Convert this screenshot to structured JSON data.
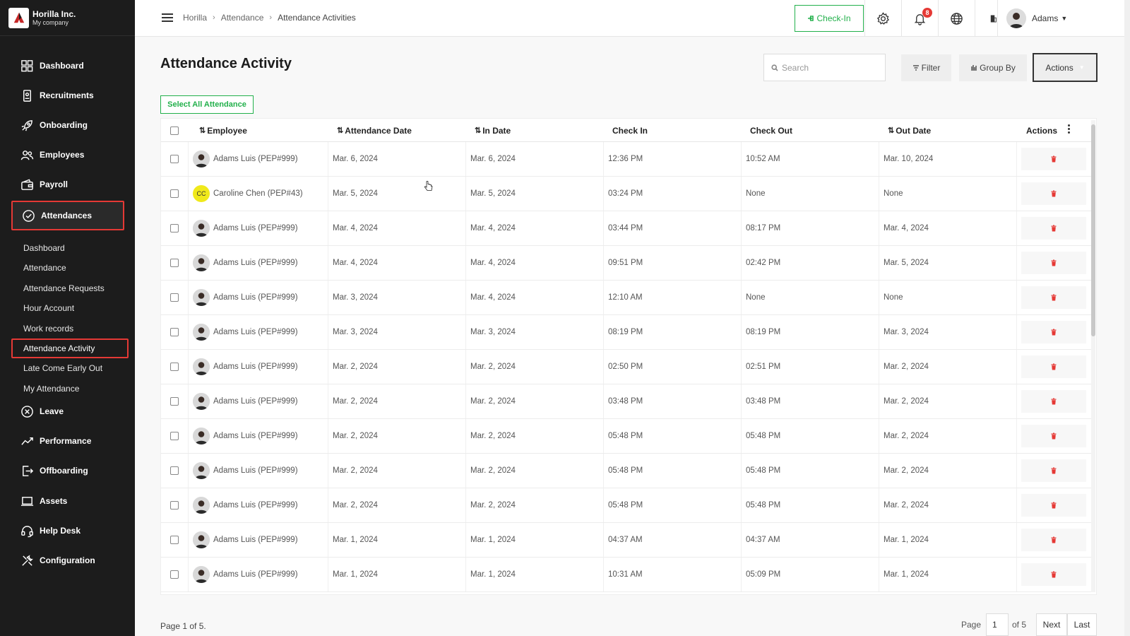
{
  "company": {
    "name": "Horilla Inc.",
    "subtitle": "My company"
  },
  "sidebar": {
    "items": [
      {
        "label": "Dashboard",
        "icon": "dashboard-icon"
      },
      {
        "label": "Recruitments",
        "icon": "recruitment-icon"
      },
      {
        "label": "Onboarding",
        "icon": "rocket-icon"
      },
      {
        "label": "Employees",
        "icon": "users-icon"
      },
      {
        "label": "Payroll",
        "icon": "wallet-icon"
      },
      {
        "label": "Attendances",
        "icon": "check-circle-icon",
        "active": true
      },
      {
        "label": "Leave",
        "icon": "leave-icon"
      },
      {
        "label": "Performance",
        "icon": "chart-line-icon"
      },
      {
        "label": "Offboarding",
        "icon": "exit-icon"
      },
      {
        "label": "Assets",
        "icon": "laptop-icon"
      },
      {
        "label": "Help Desk",
        "icon": "headset-icon"
      },
      {
        "label": "Configuration",
        "icon": "tools-icon"
      }
    ],
    "sub_items": [
      {
        "label": "Dashboard"
      },
      {
        "label": "Attendance"
      },
      {
        "label": "Attendance Requests"
      },
      {
        "label": "Hour Account"
      },
      {
        "label": "Work records"
      },
      {
        "label": "Attendance Activity",
        "active": true
      },
      {
        "label": "Late Come Early Out"
      },
      {
        "label": "My Attendance"
      }
    ]
  },
  "topbar": {
    "breadcrumbs": [
      "Horilla",
      "Attendance",
      "Attendance Activities"
    ],
    "checkin_label": "Check-In",
    "notification_count": "8",
    "user_name": "Adams"
  },
  "main": {
    "title": "Attendance Activity",
    "search_placeholder": "Search",
    "filter_label": "Filter",
    "groupby_label": "Group By",
    "actions_label": "Actions",
    "select_all_label": "Select All Attendance"
  },
  "table": {
    "columns": [
      "Employee",
      "Attendance Date",
      "In Date",
      "Check In",
      "Check Out",
      "Out Date",
      "Actions"
    ],
    "rows": [
      {
        "employee": "Adams Luis (PEP#999)",
        "avatar": "photo",
        "attendance_date": "Mar. 6, 2024",
        "in_date": "Mar. 6, 2024",
        "check_in": "12:36 PM",
        "check_out": "10:52 AM",
        "out_date": "Mar. 10, 2024"
      },
      {
        "employee": "Caroline Chen (PEP#43)",
        "avatar": "CC",
        "attendance_date": "Mar. 5, 2024",
        "in_date": "Mar. 5, 2024",
        "check_in": "03:24 PM",
        "check_out": "None",
        "out_date": "None"
      },
      {
        "employee": "Adams Luis (PEP#999)",
        "avatar": "photo",
        "attendance_date": "Mar. 4, 2024",
        "in_date": "Mar. 4, 2024",
        "check_in": "03:44 PM",
        "check_out": "08:17 PM",
        "out_date": "Mar. 4, 2024"
      },
      {
        "employee": "Adams Luis (PEP#999)",
        "avatar": "photo",
        "attendance_date": "Mar. 4, 2024",
        "in_date": "Mar. 4, 2024",
        "check_in": "09:51 PM",
        "check_out": "02:42 PM",
        "out_date": "Mar. 5, 2024"
      },
      {
        "employee": "Adams Luis (PEP#999)",
        "avatar": "photo",
        "attendance_date": "Mar. 3, 2024",
        "in_date": "Mar. 4, 2024",
        "check_in": "12:10 AM",
        "check_out": "None",
        "out_date": "None"
      },
      {
        "employee": "Adams Luis (PEP#999)",
        "avatar": "photo",
        "attendance_date": "Mar. 3, 2024",
        "in_date": "Mar. 3, 2024",
        "check_in": "08:19 PM",
        "check_out": "08:19 PM",
        "out_date": "Mar. 3, 2024"
      },
      {
        "employee": "Adams Luis (PEP#999)",
        "avatar": "photo",
        "attendance_date": "Mar. 2, 2024",
        "in_date": "Mar. 2, 2024",
        "check_in": "02:50 PM",
        "check_out": "02:51 PM",
        "out_date": "Mar. 2, 2024"
      },
      {
        "employee": "Adams Luis (PEP#999)",
        "avatar": "photo",
        "attendance_date": "Mar. 2, 2024",
        "in_date": "Mar. 2, 2024",
        "check_in": "03:48 PM",
        "check_out": "03:48 PM",
        "out_date": "Mar. 2, 2024"
      },
      {
        "employee": "Adams Luis (PEP#999)",
        "avatar": "photo",
        "attendance_date": "Mar. 2, 2024",
        "in_date": "Mar. 2, 2024",
        "check_in": "05:48 PM",
        "check_out": "05:48 PM",
        "out_date": "Mar. 2, 2024"
      },
      {
        "employee": "Adams Luis (PEP#999)",
        "avatar": "photo",
        "attendance_date": "Mar. 2, 2024",
        "in_date": "Mar. 2, 2024",
        "check_in": "05:48 PM",
        "check_out": "05:48 PM",
        "out_date": "Mar. 2, 2024"
      },
      {
        "employee": "Adams Luis (PEP#999)",
        "avatar": "photo",
        "attendance_date": "Mar. 2, 2024",
        "in_date": "Mar. 2, 2024",
        "check_in": "05:48 PM",
        "check_out": "05:48 PM",
        "out_date": "Mar. 2, 2024"
      },
      {
        "employee": "Adams Luis (PEP#999)",
        "avatar": "photo",
        "attendance_date": "Mar. 1, 2024",
        "in_date": "Mar. 1, 2024",
        "check_in": "04:37 AM",
        "check_out": "04:37 AM",
        "out_date": "Mar. 1, 2024"
      },
      {
        "employee": "Adams Luis (PEP#999)",
        "avatar": "photo",
        "attendance_date": "Mar. 1, 2024",
        "in_date": "Mar. 1, 2024",
        "check_in": "10:31 AM",
        "check_out": "05:09 PM",
        "out_date": "Mar. 1, 2024"
      }
    ]
  },
  "pagination": {
    "summary": "Page 1 of 5.",
    "page_label": "Page",
    "current_page": "1",
    "of_label": "of 5",
    "next_label": "Next",
    "last_label": "Last"
  },
  "colors": {
    "accent": "#e53935",
    "success": "#22b04b",
    "sidebar": "#1c1c1c"
  }
}
